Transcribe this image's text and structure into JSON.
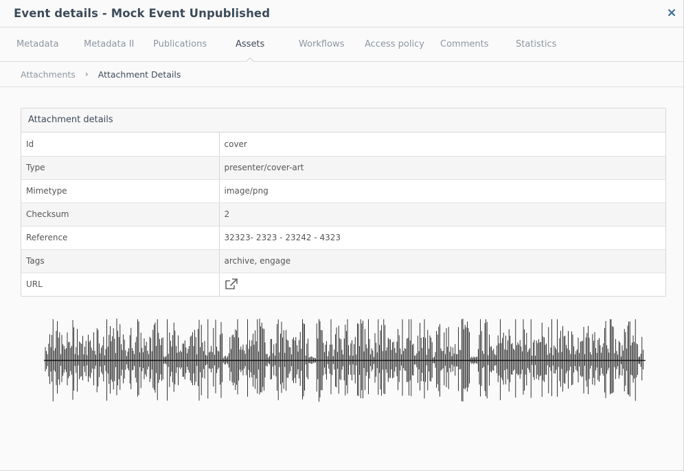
{
  "modal": {
    "title": "Event details - Mock Event Unpublished",
    "close_glyph": "×"
  },
  "tabs": [
    {
      "label": "Metadata",
      "active": false
    },
    {
      "label": "Metadata II",
      "active": false
    },
    {
      "label": "Publications",
      "active": false
    },
    {
      "label": "Assets",
      "active": true
    },
    {
      "label": "Workflows",
      "active": false
    },
    {
      "label": "Access policy",
      "active": false
    },
    {
      "label": "Comments",
      "active": false
    },
    {
      "label": "Statistics",
      "active": false
    }
  ],
  "breadcrumb": {
    "parent": "Attachments",
    "separator": "›",
    "current": "Attachment Details"
  },
  "panel": {
    "title": "Attachment details",
    "rows": [
      {
        "key": "Id",
        "value": "cover"
      },
      {
        "key": "Type",
        "value": "presenter/cover-art"
      },
      {
        "key": "Mimetype",
        "value": "image/png"
      },
      {
        "key": "Checksum",
        "value": "2"
      },
      {
        "key": "Reference",
        "value": "32323- 2323 - 23242 - 4323"
      },
      {
        "key": "Tags",
        "value": "archive, engage"
      },
      {
        "key": "URL",
        "value": "",
        "icon": "external-link-icon"
      }
    ]
  },
  "colors": {
    "accent": "#3a6a9a",
    "text_dark": "#3d4b5a",
    "text_muted": "#8d97a1",
    "waveform": "#000000"
  }
}
